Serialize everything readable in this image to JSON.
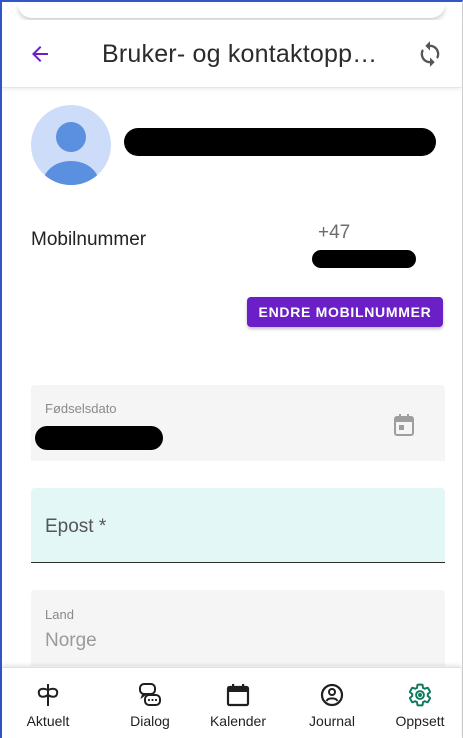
{
  "app": {
    "title": "Bruker- og kontaktopp…",
    "back_icon": "arrow-left-icon",
    "sync_icon": "sync-icon",
    "accent_color": "#6a1fc7"
  },
  "profile": {
    "name_redacted": true
  },
  "mobile": {
    "label": "Mobilnummer",
    "prefix": "+47",
    "change_button_label": "ENDRE MOBILNUMMER"
  },
  "birthdate": {
    "label": "Fødselsdato",
    "icon": "calendar-icon"
  },
  "email": {
    "label": "Epost *"
  },
  "country": {
    "label": "Land",
    "value": "Norge"
  },
  "bottom_nav": {
    "items": [
      {
        "label": "Aktuelt",
        "icon": "aktuelt-icon"
      },
      {
        "label": "Dialog",
        "icon": "dialog-icon"
      },
      {
        "label": "Kalender",
        "icon": "calendar-icon"
      },
      {
        "label": "Journal",
        "icon": "journal-icon"
      },
      {
        "label": "Oppsett",
        "icon": "gear-icon",
        "active": true,
        "color": "#0d7a5f"
      }
    ]
  }
}
